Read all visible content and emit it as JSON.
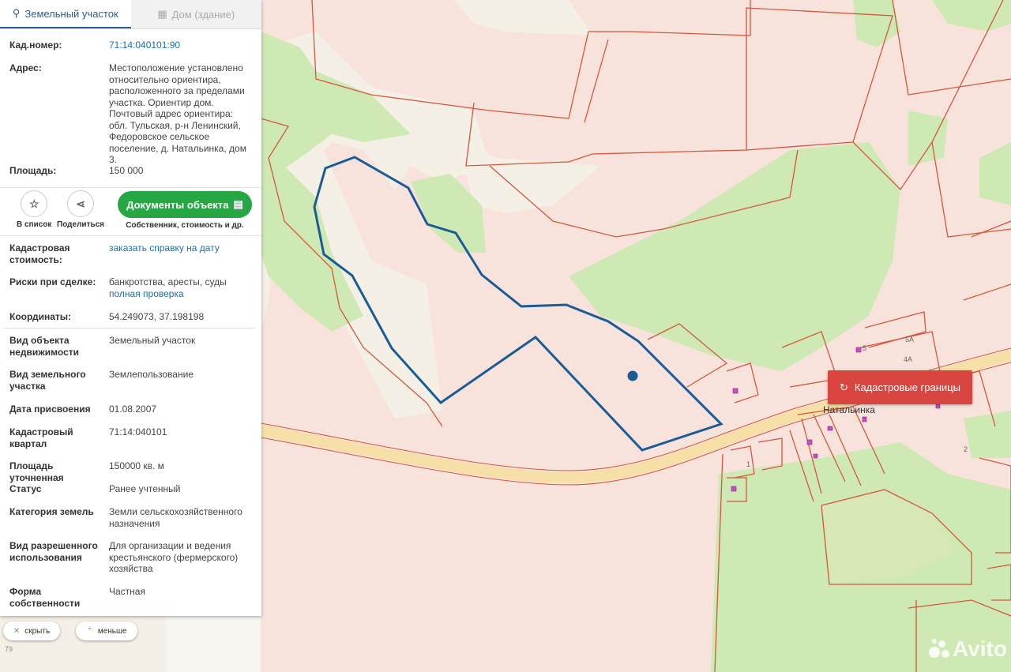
{
  "tabs": {
    "land": "Земельный участок",
    "building": "Дом (здание)"
  },
  "info": {
    "cad_label": "Кад.номер:",
    "cad_value": "71:14:040101:90",
    "addr_label": "Адрес:",
    "addr_value": "Местоположение установлено относительно ориентира, расположенного за пределами участка. Ориентир дом. Почтовый адрес ориентира: обл. Тульская, р-н Ленинский, Федоровское сельское поселение, д. Натальинка, дом 3.",
    "area_label": "Площадь:",
    "area_value": "150 000"
  },
  "actions": {
    "fav": "В список",
    "share": "Поделиться",
    "docs": "Документы объекта",
    "docs_sub": "Собственник, стоимость и др."
  },
  "details": {
    "cost_label": "Кадастровая стоимость:",
    "cost_link": "заказать справку на дату",
    "risk_label": "Риски при сделке:",
    "risk_value": "банкротства, аресты, суды",
    "risk_link": "полная проверка",
    "coord_label": "Координаты:",
    "coord_value": "54.249073, 37.198198"
  },
  "props": [
    {
      "label": "Вид объекта недвижимости",
      "value": "Земельный участок"
    },
    {
      "label": "Вид земельного участка",
      "value": "Землепользование"
    },
    {
      "label": "Дата присвоения",
      "value": "01.08.2007"
    },
    {
      "label": "Кадастровый квартал",
      "value": "71:14:040101"
    },
    {
      "label": "Площадь уточненная",
      "value": "150000 кв. м"
    },
    {
      "label": "Статус",
      "value": "Ранее учтенный"
    },
    {
      "label": "Категория земель",
      "value": "Земли сельскохозяйственного назначения"
    },
    {
      "label": "Вид разрешенного использования",
      "value": "Для организации и ведения крестьянского (фермерского) хозяйства"
    },
    {
      "label": "Форма собственности",
      "value": "Частная"
    }
  ],
  "footer": {
    "hide": "скрыть",
    "less": "меньше"
  },
  "map": {
    "cad_button": "Кадастровые границы",
    "place": "Натальинка",
    "house_5a": "5А",
    "house_4a": "4А",
    "house_5": "5",
    "house_2": "2",
    "house_1": "1",
    "num_79": "79",
    "watermark": "Avito"
  },
  "colors": {
    "parcel": "#f7e3dc",
    "boundary": "#d2583e",
    "forest": "#cfe9b4",
    "selected": "#1a5d96",
    "road": "#f7e0a8"
  }
}
